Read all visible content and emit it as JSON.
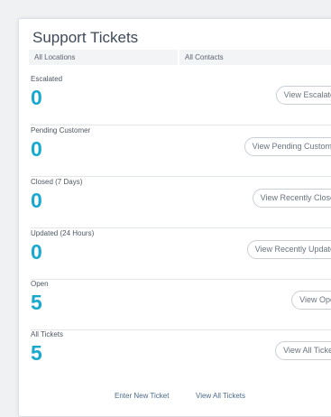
{
  "header": {
    "title": "Support Tickets"
  },
  "filters": {
    "locations": "All Locations",
    "contacts": "All Contacts"
  },
  "sections": [
    {
      "label": "Escalated",
      "count": "0",
      "button": "View Escalated"
    },
    {
      "label": "Pending Customer",
      "count": "0",
      "button": "View Pending Customer"
    },
    {
      "label": "Closed (7 Days)",
      "count": "0",
      "button": "View Recently Closed"
    },
    {
      "label": "Updated (24 Hours)",
      "count": "0",
      "button": "View Recently Updated"
    },
    {
      "label": "Open",
      "count": "5",
      "button": "View Open"
    },
    {
      "label": "All Tickets",
      "count": "5",
      "button": "View All Tickets"
    }
  ],
  "footer": {
    "enter_new": "Enter New Ticket",
    "view_all": "View All Tickets"
  },
  "colors": {
    "count": "#1aa8d0",
    "title": "#3e4a58",
    "link": "#4a6a8a"
  }
}
